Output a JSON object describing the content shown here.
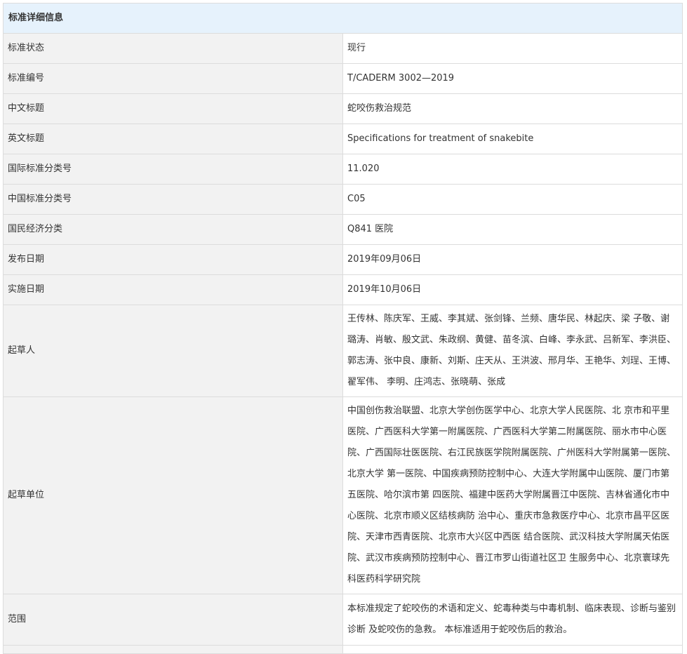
{
  "section_title": "标准详细信息",
  "rows": [
    {
      "label": "标准状态",
      "value": "现行"
    },
    {
      "label": "标准编号",
      "value": "T/CADERM 3002—2019"
    },
    {
      "label": "中文标题",
      "value": "蛇咬伤救治规范"
    },
    {
      "label": "英文标题",
      "value": "Specifications for treatment of snakebite"
    },
    {
      "label": "国际标准分类号",
      "value": "11.020"
    },
    {
      "label": "中国标准分类号",
      "value": "C05"
    },
    {
      "label": "国民经济分类",
      "value": "Q841 医院"
    },
    {
      "label": "发布日期",
      "value": "2019年09月06日"
    },
    {
      "label": "实施日期",
      "value": "2019年10月06日"
    },
    {
      "label": "起草人",
      "value": "王传林、陈庆军、王威、李其斌、张剑锋、兰频、唐华民、林起庆、梁 子敬、谢璐涛、肖敏、殷文武、朱政纲、黄健、苗冬滨、白峰、李永武、吕新军、李洪臣、 郭志涛、张中良、康新、刘斯、庄天从、王洪波、邢月华、王艳华、刘珵、王博、翟军伟、 李明、庄鸿志、张晓萌、张成"
    },
    {
      "label": "起草单位",
      "value": "中国创伤救治联盟、北京大学创伤医学中心、北京大学人民医院、北 京市和平里医院、广西医科大学第一附属医院、广西医科大学第二附属医院、丽水市中心医 院、广西国际壮医医院、右江民族医学院附属医院、广州医科大学附属第一医院、北京大学 第一医院、中国疾病预防控制中心、大连大学附属中山医院、厦门市第五医院、哈尔滨市第 四医院、福建中医药大学附属晋江中医院、吉林省通化市中心医院、北京市顺义区结核病防 治中心、重庆市急救医疗中心、北京市昌平区医院、天津市西青医院、北京市大兴区中西医 结合医院、武汉科技大学附属天佑医院、武汉市疾病预防控制中心、晋江市罗山街道社区卫 生服务中心、北京寰球先科医药科学研究院"
    },
    {
      "label": "范围",
      "value": "本标准规定了蛇咬伤的术语和定义、蛇毒种类与中毒机制、临床表现、诊断与鉴别诊断 及蛇咬伤的急救。 本标准适用于蛇咬伤后的救治。"
    }
  ]
}
